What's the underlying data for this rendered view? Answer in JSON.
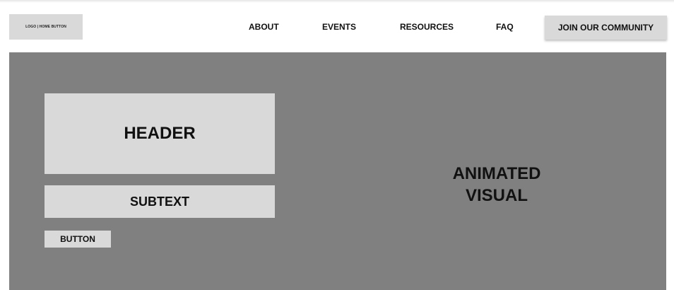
{
  "nav": {
    "logo_label": "LOGO | HOME BUTTON",
    "links": [
      "ABOUT",
      "EVENTS",
      "RESOURCES",
      "FAQ"
    ],
    "cta_label": "JOIN OUR COMMUNITY"
  },
  "hero": {
    "header": "HEADER",
    "subtext": "SUBTEXT",
    "button_label": "BUTTON",
    "visual_line1": "ANIMATED",
    "visual_line2": "VISUAL"
  },
  "colors": {
    "hero_bg": "#808080",
    "block_bg": "#d9d9d9",
    "text": "#111111"
  }
}
